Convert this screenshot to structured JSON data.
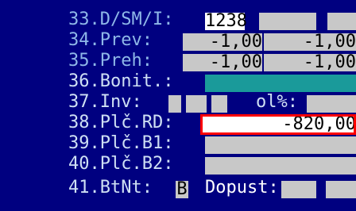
{
  "rows": {
    "r33": {
      "label": "33.D/SM/I:",
      "value": "1238"
    },
    "r34": {
      "label": "34.Prev:",
      "v1": "-1,00",
      "v2": "-1,00"
    },
    "r35": {
      "label": "35.Preh:",
      "v1": "-1,00",
      "v2": "-1,00"
    },
    "r36": {
      "label": "36.Bonit.:"
    },
    "r37": {
      "label": "37.Inv:",
      "sub_label": "ol%:"
    },
    "r38": {
      "label": "38.Plč.RD:",
      "value": "-820,00"
    },
    "r39": {
      "label": "39.Plč.B1:"
    },
    "r40": {
      "label": "40.Plč.B2:"
    },
    "r41": {
      "label": "41.BtNt:",
      "flag": "B",
      "sub_label": "Dopust:"
    }
  },
  "colors": {
    "background": "#000080",
    "label_text": "#8fb8e8",
    "field_bg": "#c8c8c8",
    "teal_bar": "#1a9a9a",
    "highlight_border": "#ff0000"
  }
}
